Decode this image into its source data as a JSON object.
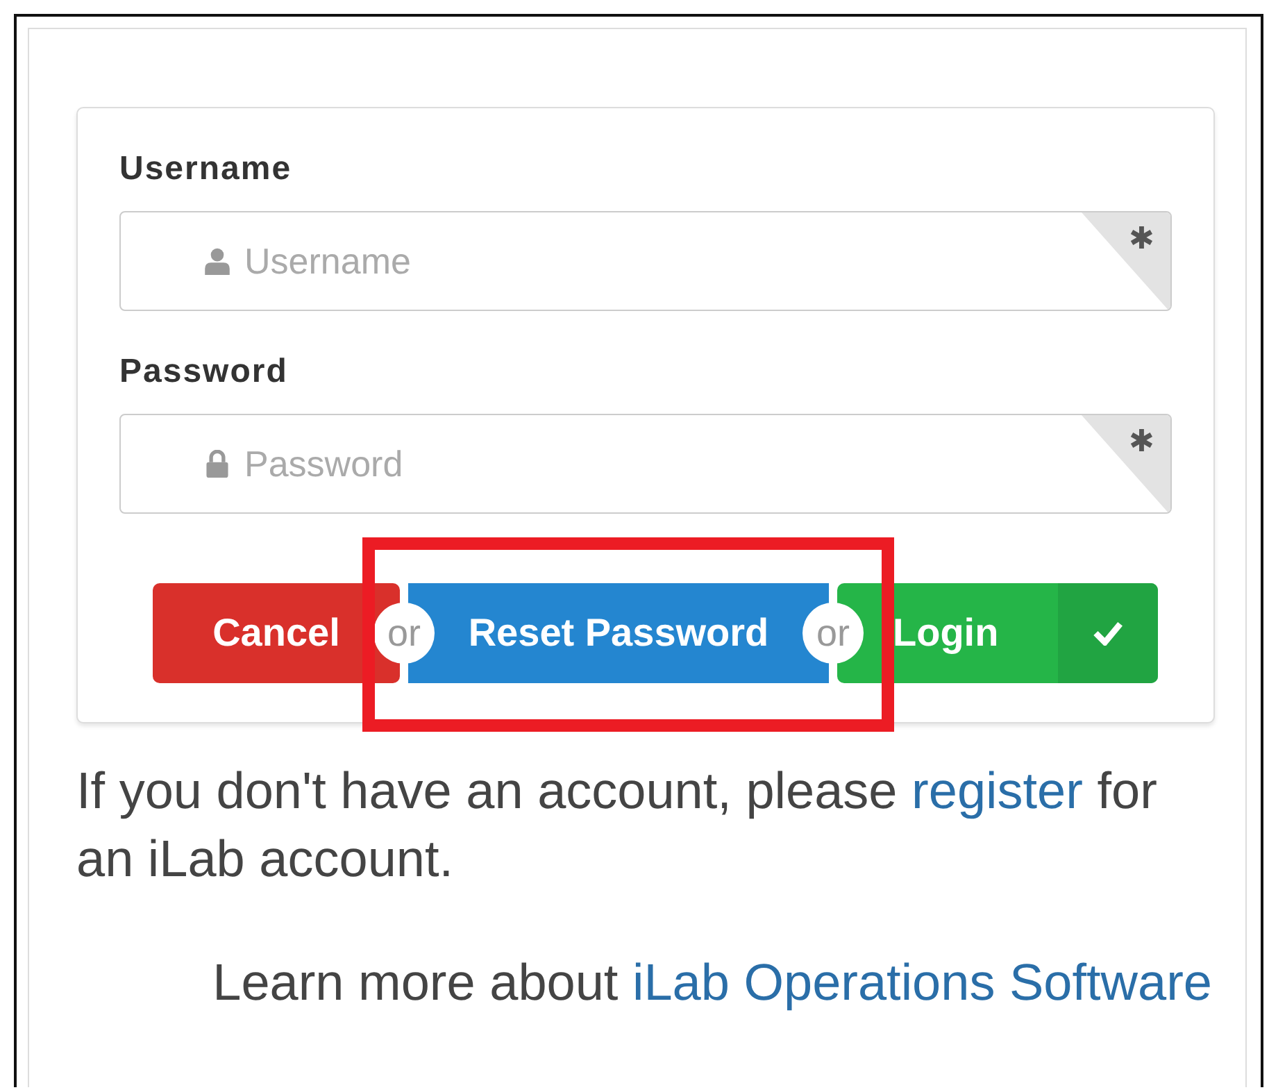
{
  "fields": [
    {
      "kind": "user",
      "label": "Username",
      "placeholder": "Username",
      "required_mark": "✱"
    },
    {
      "kind": "password",
      "label": "Password",
      "placeholder": "Password",
      "required_mark": "✱"
    }
  ],
  "buttons": [
    {
      "kind": "cancel",
      "label": "Cancel",
      "highlighted": false
    },
    {
      "kind": "reset",
      "label": "Reset Password",
      "highlighted": true
    },
    {
      "kind": "login",
      "label": "Login",
      "highlighted": false
    }
  ],
  "separators": [
    "or",
    "or"
  ],
  "note": {
    "before": "If you don't have an account, please ",
    "link": "register",
    "after": " for an iLab account."
  },
  "footer": {
    "before": "Learn more about ",
    "link": "iLab Operations Software"
  }
}
